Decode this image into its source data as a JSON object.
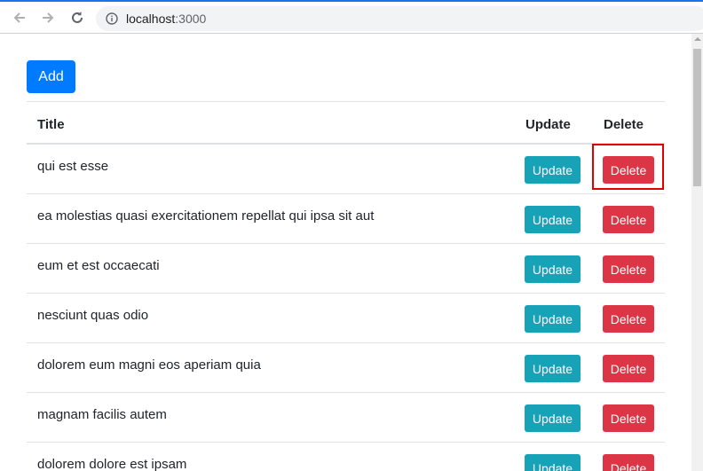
{
  "browser": {
    "url_host": "localhost",
    "url_port": ":3000",
    "accent": "#1a73e8"
  },
  "page": {
    "add_label": "Add",
    "headers": {
      "title": "Title",
      "update": "Update",
      "delete": "Delete"
    },
    "rows": [
      {
        "title": "qui est esse",
        "update": "Update",
        "delete": "Delete"
      },
      {
        "title": "ea molestias quasi exercitationem repellat qui ipsa sit aut",
        "update": "Update",
        "delete": "Delete"
      },
      {
        "title": "eum et est occaecati",
        "update": "Update",
        "delete": "Delete"
      },
      {
        "title": "nesciunt quas odio",
        "update": "Update",
        "delete": "Delete"
      },
      {
        "title": "dolorem eum magni eos aperiam quia",
        "update": "Update",
        "delete": "Delete"
      },
      {
        "title": "magnam facilis autem",
        "update": "Update",
        "delete": "Delete"
      },
      {
        "title": "dolorem dolore est ipsam",
        "update": "Update",
        "delete": "Delete"
      }
    ],
    "colors": {
      "primary": "#007bff",
      "info": "#17a2b8",
      "danger": "#dc3545",
      "highlight": "#e00000"
    }
  }
}
